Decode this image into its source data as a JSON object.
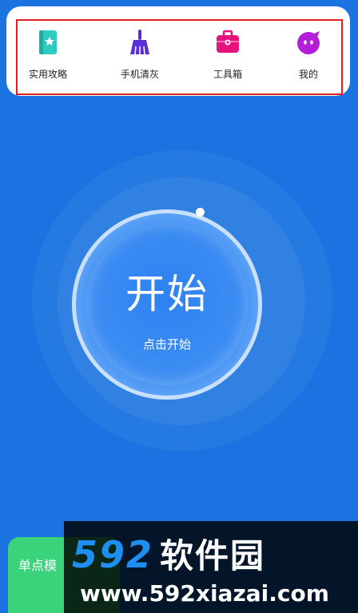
{
  "nav": {
    "items": [
      {
        "label": "实用攻略",
        "icon": "guide-book-icon",
        "color": "#2ec9c0"
      },
      {
        "label": "手机清灰",
        "icon": "broom-icon",
        "color": "#5b2fd6"
      },
      {
        "label": "工具箱",
        "icon": "toolbox-icon",
        "color": "#e5127d"
      },
      {
        "label": "我的",
        "icon": "profile-face-icon",
        "color": "#b21fd6"
      }
    ]
  },
  "main": {
    "start_title": "开始",
    "start_subtitle": "点击开始"
  },
  "bottom": {
    "mode_label": "单点模"
  },
  "watermark": {
    "logo_digits": "592",
    "logo_text": "软件园",
    "url": "www.592xiazai.com"
  },
  "colors": {
    "background": "#1a73e0",
    "highlight": "#e01e1e",
    "mode_button": "#3ad37c"
  }
}
